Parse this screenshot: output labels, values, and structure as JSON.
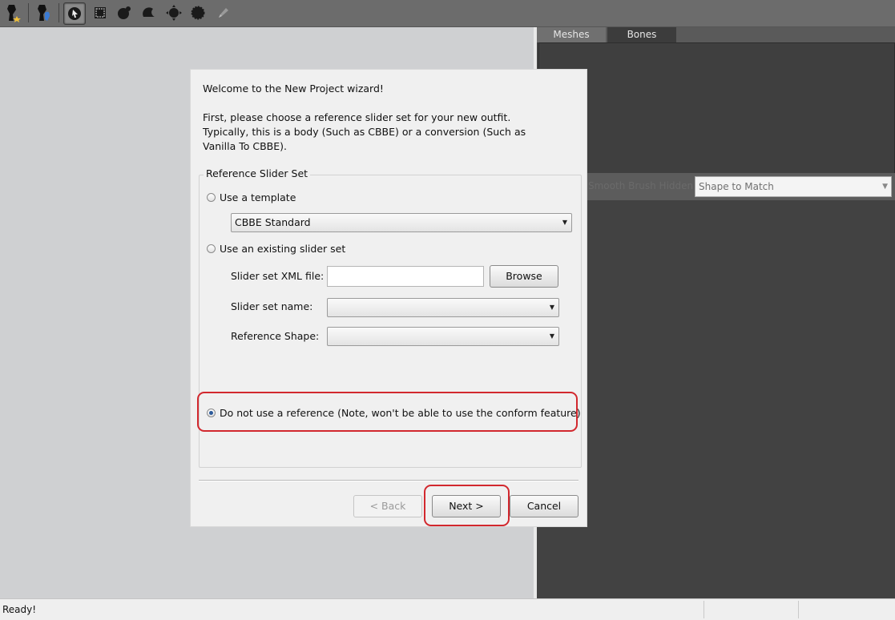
{
  "toolbar": {
    "tools": [
      {
        "icon": "new-project-icon"
      },
      {
        "icon": "load-outfit-icon"
      },
      {
        "icon": "select-tool-icon",
        "active": true
      },
      {
        "icon": "mask-tool-icon"
      },
      {
        "icon": "inflate-brush-icon"
      },
      {
        "icon": "deflate-brush-icon"
      },
      {
        "icon": "move-brush-icon"
      },
      {
        "icon": "smooth-brush-icon"
      },
      {
        "icon": "weight-brush-icon"
      }
    ]
  },
  "right_panel": {
    "tabs": [
      "Meshes",
      "Bones"
    ],
    "shape_to_match_placeholder": "Shape to Match",
    "faint_label": "Smooth Brush Hidden"
  },
  "status": {
    "text": "Ready!"
  },
  "dialog": {
    "welcome": "Welcome to the New Project wizard!",
    "intro_lines": [
      "First, please choose a reference slider set for your new outfit.",
      "Typically, this is a body (Such as CBBE) or a conversion (Such as",
      "Vanilla To CBBE)."
    ],
    "group_title": "Reference Slider Set",
    "option_template": "Use a template",
    "template_value": "CBBE Standard",
    "option_existing": "Use an existing slider set",
    "xml_label": "Slider set XML file:",
    "xml_value": "",
    "browse_label": "Browse",
    "name_label": "Slider set name:",
    "name_value": "",
    "shape_label": "Reference Shape:",
    "shape_value": "",
    "option_none": "Do not use a reference  (Note, won't be able to use the conform feature)",
    "selected_option": "none",
    "back_label": "< Back",
    "next_label": "Next >",
    "cancel_label": "Cancel"
  },
  "colors": {
    "highlight": "#d2282e",
    "panel_dark": "#424242",
    "viewport": "#cfd0d2"
  }
}
